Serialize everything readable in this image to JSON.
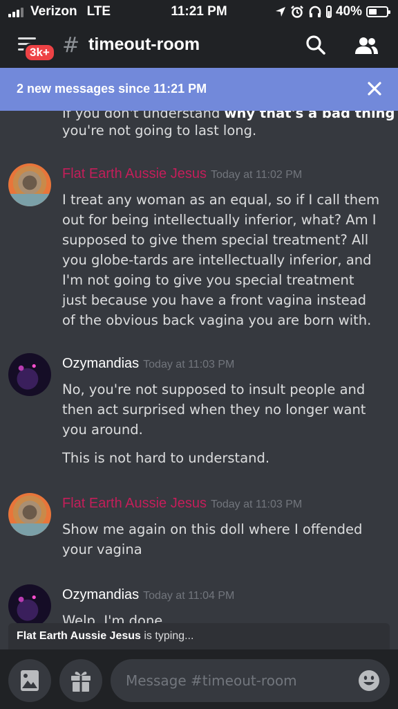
{
  "status_bar": {
    "carrier": "Verizon",
    "network": "LTE",
    "time": "11:21 PM",
    "battery": "40%"
  },
  "header": {
    "badge": "3k+",
    "channel_name": "timeout-room"
  },
  "banner": {
    "text": "2 new messages since 11:21 PM"
  },
  "messages": [
    {
      "author": "",
      "timestamp": "",
      "cut_top_plain": "If you don't understand ",
      "cut_top_bold": "why that's a bad thing",
      "lines": [
        "you're not going to last long."
      ]
    },
    {
      "author": "Flat Earth Aussie Jesus",
      "timestamp": "Today at 11:02 PM",
      "lines": [
        "I treat any woman as an equal, so if I call them out for being intellectually inferior, what? Am I supposed to give them special treatment? All you globe-tards are intellectually inferior, and I'm not going to give you special treatment just because you have a front vagina instead of the obvious back vagina  you are born with."
      ]
    },
    {
      "author": "Ozymandias",
      "timestamp": "Today at 11:03 PM",
      "lines": [
        "No, you're not supposed to insult people and then act surprised when they no longer want you around.",
        "This is not hard to understand."
      ]
    },
    {
      "author": "Flat Earth Aussie Jesus",
      "timestamp": "Today at 11:03 PM",
      "lines": [
        "Show me again on this doll where I offended your vagina"
      ]
    },
    {
      "author": "Ozymandias",
      "timestamp": "Today at 11:04 PM",
      "lines": [
        "Welp, I'm done."
      ]
    }
  ],
  "typing": {
    "user": "Flat Earth Aussie Jesus",
    "suffix": " is typing..."
  },
  "composer": {
    "placeholder": "Message #timeout-room"
  },
  "colors": {
    "background": "#36393f",
    "header": "#202225",
    "banner": "#7289da",
    "author_pink": "#c41e5a",
    "badge_red": "#ed4245"
  },
  "icons": [
    "signal-icon",
    "navigation-arrow-icon",
    "alarm-icon",
    "headphones-icon",
    "battery-icon",
    "menu-icon",
    "hash-icon",
    "search-icon",
    "members-icon",
    "close-icon",
    "image-icon",
    "gift-icon",
    "emoji-icon"
  ]
}
